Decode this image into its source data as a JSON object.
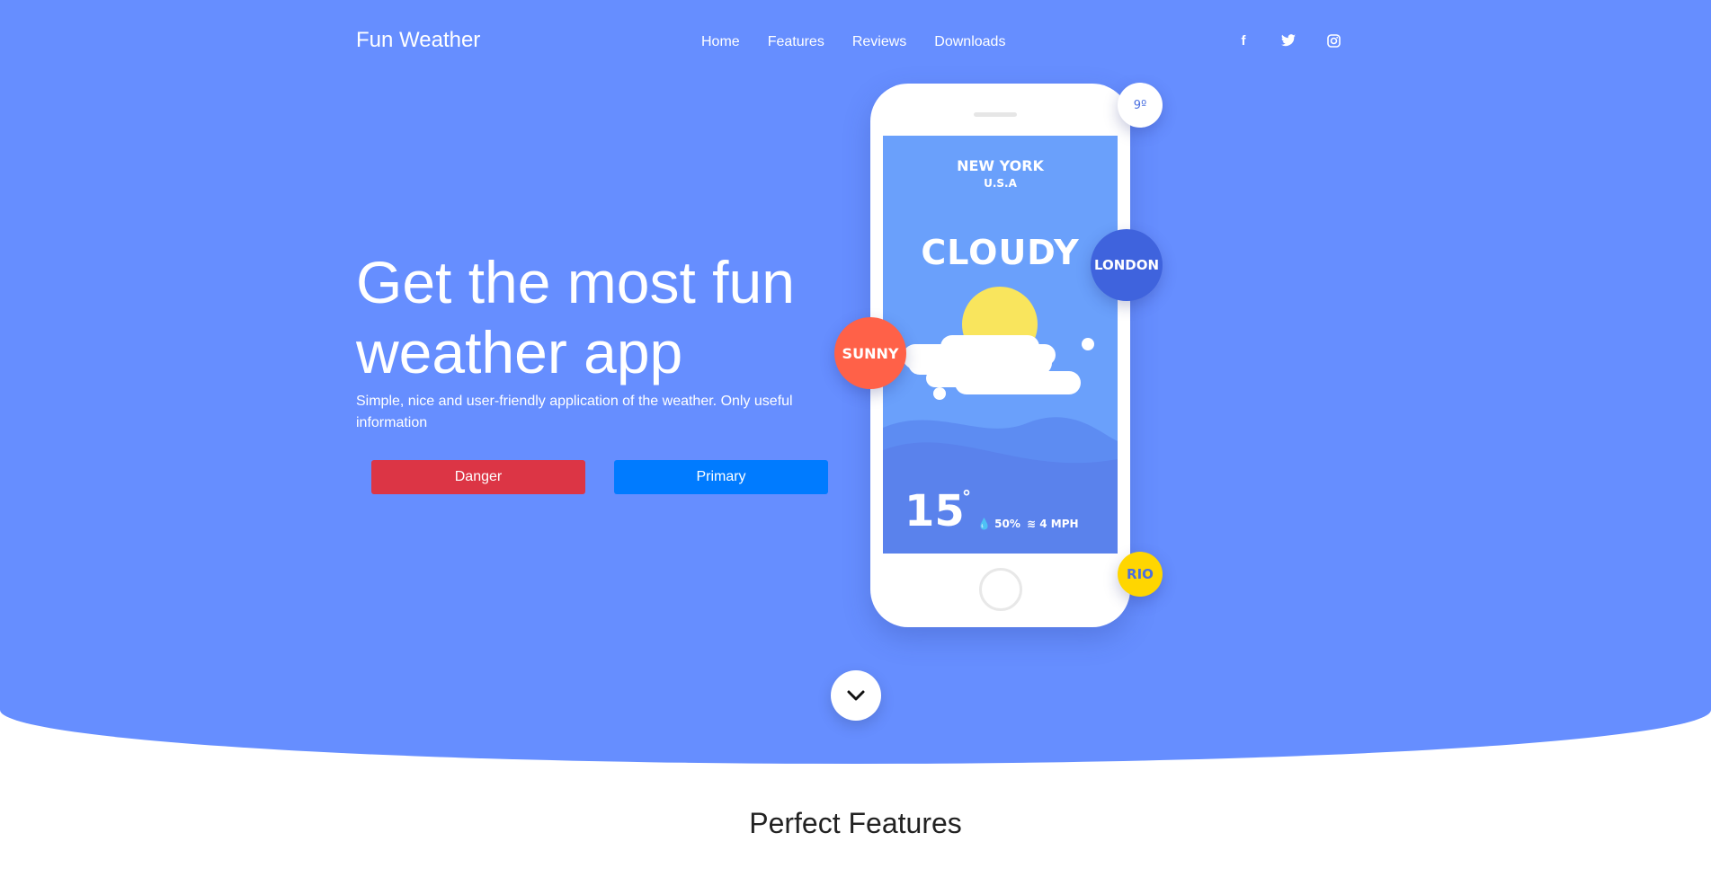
{
  "header": {
    "brand": "Fun Weather",
    "nav": [
      "Home",
      "Features",
      "Reviews",
      "Downloads"
    ],
    "social_icons": [
      "facebook-icon",
      "twitter-icon",
      "instagram-icon"
    ]
  },
  "hero": {
    "headline": "Get the most fun weather app",
    "subtext": "Simple, nice and user-friendly application of the weather. Only useful information",
    "buttons": {
      "danger": "Danger",
      "primary": "Primary"
    },
    "colors": {
      "background": "#668eff",
      "danger": "#dc3545",
      "primary": "#007bff"
    }
  },
  "phone": {
    "city": "NEW YORK",
    "country": "U.S.A",
    "condition": "CLOUDY",
    "temperature": "15",
    "degree": "°",
    "humidity": "50%",
    "wind": "4 MPH"
  },
  "bubbles": {
    "temp": "9º",
    "london": "LONDON",
    "sunny": "SUNNY",
    "rio": "RIO"
  },
  "scroll_icon": "chevron-down-icon",
  "section": {
    "title": "Perfect Features"
  }
}
